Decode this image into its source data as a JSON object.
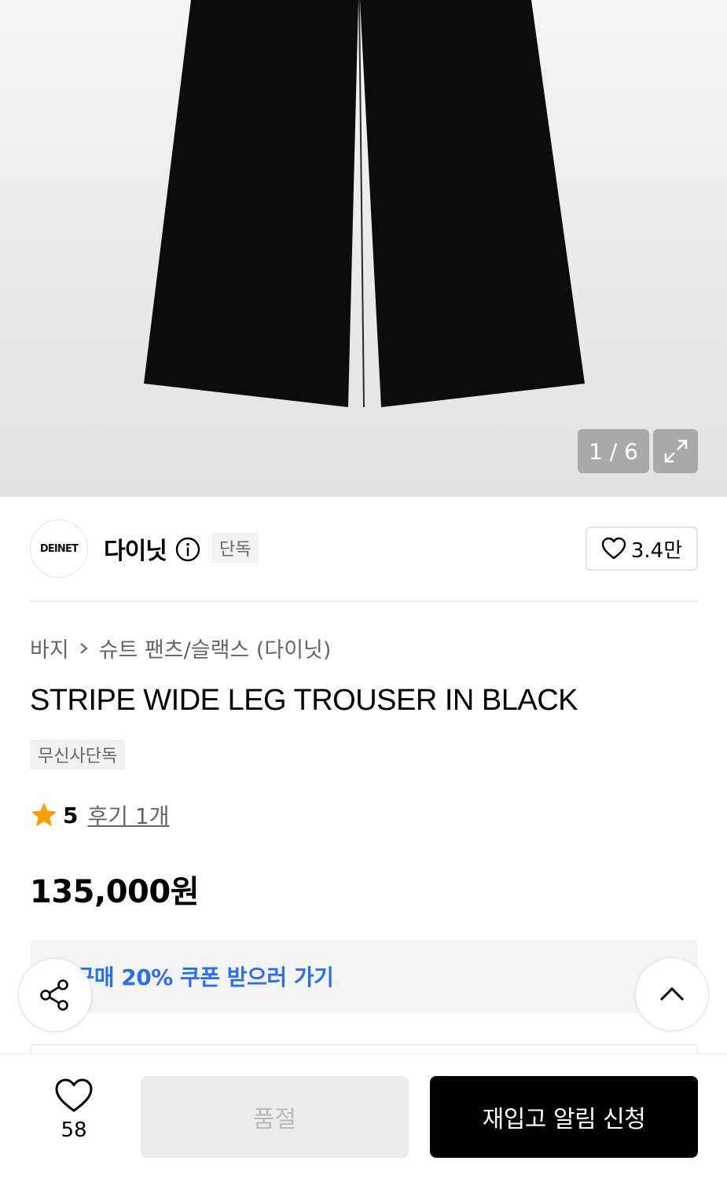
{
  "gallery": {
    "counter": "1 / 6",
    "icons": {
      "zoom": "expand-arrows-icon"
    }
  },
  "brand": {
    "logo_text": "DEINET",
    "name": "다이닛",
    "exclusive_badge": "단독",
    "likes": "3.4만",
    "icons": {
      "info": "info-circle-icon",
      "like": "heart-outline-icon"
    }
  },
  "breadcrumb": {
    "category": "바지",
    "subcategory": "슈트 팬츠/슬랙스 (다이닛)"
  },
  "product": {
    "title": "STRIPE WIDE LEG TROUSER IN BLACK",
    "tag": "무신사단독",
    "rating": "5",
    "reviews": "후기 1개",
    "price": "135,000원"
  },
  "coupon": {
    "text": "첫 구매 20% 쿠폰 받으러 가기",
    "accent_color": "#2a6ff0"
  },
  "floating": {
    "share_icon": "share-icon",
    "top_icon": "chevron-up-icon"
  },
  "bottom_bar": {
    "wish_count": "58",
    "soldout_label": "품절",
    "restock_label": "재입고 알림 신청"
  }
}
